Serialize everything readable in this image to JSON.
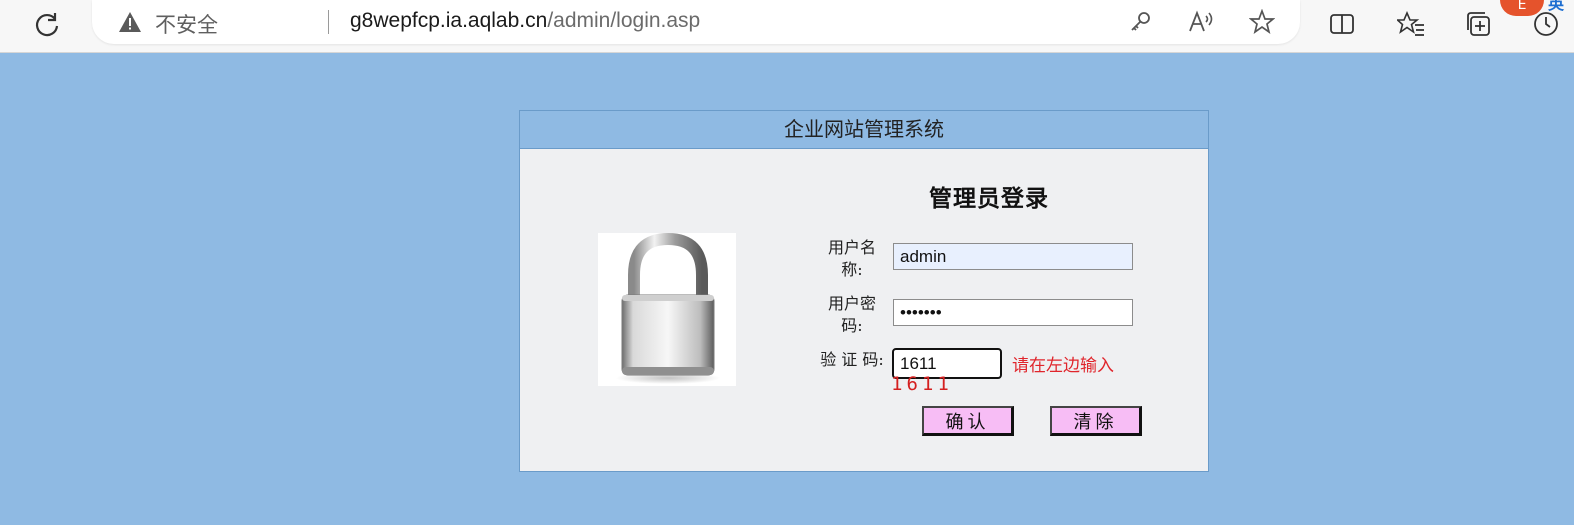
{
  "browser": {
    "security_label": "不安全",
    "url_host": "g8wepfcp.ia.aqlab.cn",
    "url_path": "/admin/login.asp",
    "badge_text": "E",
    "badge2_text": "英"
  },
  "panel": {
    "header_title": "企业网站管理系统",
    "login_title": "管理员登录"
  },
  "form": {
    "username_label": "用户名称:",
    "username_value": "admin",
    "password_label": "用户密码:",
    "password_value": "•••••••",
    "code_label": "验 证 码:",
    "code_value": "1611",
    "code_hint": "请在左边输入",
    "captcha_text": "1611",
    "submit_label": "确认",
    "clear_label": "清除"
  },
  "colors": {
    "page_background": "#8fbae3",
    "panel_background": "#eff0f2",
    "button_background": "#f7bdf5",
    "hint_color": "#e0252c"
  }
}
